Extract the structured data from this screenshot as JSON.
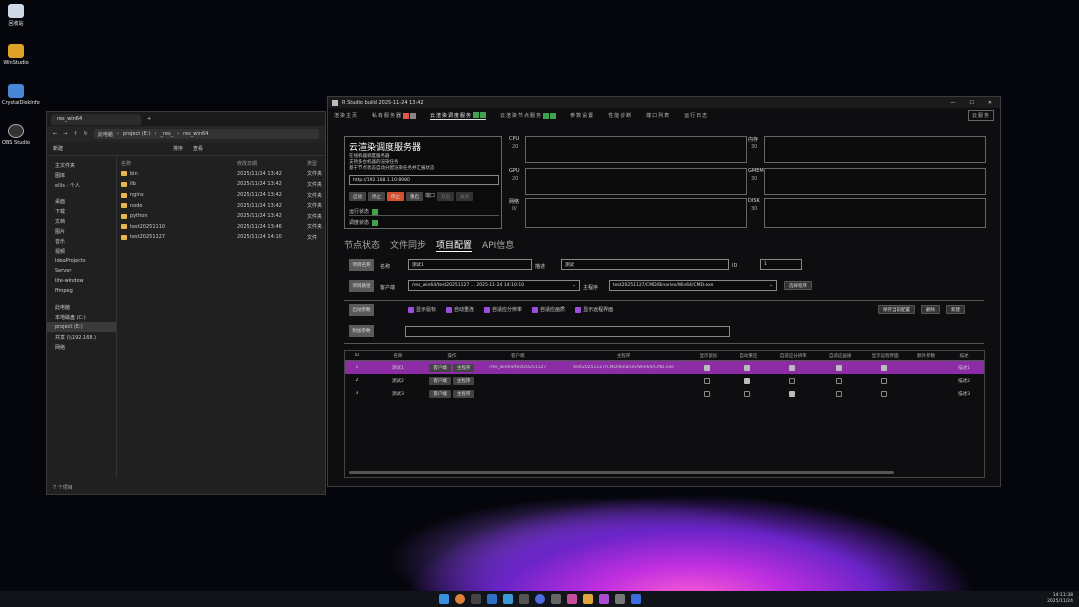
{
  "desktop": {
    "icons": [
      "回收站",
      "WinStudio",
      "CrystalDiskInfo",
      "OBS Studio"
    ]
  },
  "explorer": {
    "tab_title": "res_win64",
    "breadcrumb": [
      "此电脑",
      "project (E:)",
      "_res_",
      "res_win64"
    ],
    "toolbar": [
      "新建",
      "排序",
      "查看"
    ],
    "nav": [
      "主文件夹",
      "图库",
      "ellis - 个人",
      "桌面",
      "下载",
      "文档",
      "图片",
      "音乐",
      "视频",
      "IdeaProjects",
      "Server",
      "lite-window",
      "ffmpeg",
      "图片",
      "此电脑",
      "本地磁盘 (C:)",
      "project (E:)",
      "共享 (\\\\192.168.)",
      "网络"
    ],
    "columns": [
      "名称",
      "修改日期",
      "类型"
    ],
    "rows": [
      {
        "name": "bin",
        "date": "2025/11/24 13:42",
        "type": "文件夹"
      },
      {
        "name": "lib",
        "date": "2025/11/24 13:42",
        "type": "文件夹"
      },
      {
        "name": "nginx",
        "date": "2025/11/24 13:42",
        "type": "文件夹"
      },
      {
        "name": "node",
        "date": "2025/11/24 13:42",
        "type": "文件夹"
      },
      {
        "name": "python",
        "date": "2025/11/24 13:42",
        "type": "文件夹"
      },
      {
        "name": "test20251110",
        "date": "2025/11/24 13:46",
        "type": "文件夹"
      },
      {
        "name": "test20251127",
        "date": "2025/11/24 14:10",
        "type": "文件"
      }
    ],
    "status": "7 个项目"
  },
  "app": {
    "title": "R Studio build 2025-11-24 13:42",
    "menu": [
      "渲染主页",
      "私有服务器",
      "云渲染调度服务",
      "云渲染节点服务",
      "参数设置",
      "性能诊断",
      "端口列表",
      "运行日志"
    ],
    "menu_right": "云服务",
    "server": {
      "title": "云渲染调度服务器",
      "desc": [
        "在线机器调度服务器",
        "支持多台机器的渲染任务",
        "基于节点状态自动分配渲染任务并汇报状态"
      ],
      "url": "http://192.168.1.10:8080",
      "buttons": [
        "启动",
        "停止",
        "停止",
        "重启",
        "端口",
        "开启",
        "关闭"
      ],
      "rows": [
        "运行状态",
        "调度状态"
      ]
    },
    "monitors": [
      {
        "label": "CPU",
        "val": "20"
      },
      {
        "label": "GPU",
        "val": "20"
      },
      {
        "label": "网络",
        "val": "0/"
      },
      {
        "label": "内存",
        "val": "30"
      },
      {
        "label": "GMEM",
        "val": "30"
      },
      {
        "label": "DISK",
        "val": "30"
      }
    ],
    "subtabs": [
      "节点状态",
      "文件同步",
      "项目配置",
      "API信息"
    ],
    "form": {
      "name_label": "项目名称",
      "name_key": "名称",
      "name_value": "测试1",
      "desc_key": "描述",
      "desc_value": "测试",
      "id_key": "ID",
      "id_value": "1",
      "path_label": "项目路径",
      "client_key": "客户端",
      "client_path": "/res_win64/test20251127 ... 2025-11-24 14:10:10",
      "exe_key": "主程序",
      "exe_value": "test20251127/CMD/Binaries/Win64/CMD.exe",
      "choose": "选择程序",
      "opt_label": "启动参数",
      "options": [
        "显示鼠标",
        "自动重连",
        "自适应分辨率",
        "自适应画质",
        "显示远程界面"
      ],
      "opt_buttons": [
        "保存当前配置",
        "删除",
        "新建"
      ],
      "extra_label": "附加参数"
    },
    "table": {
      "headers": [
        "ID",
        "名称",
        "操作",
        "客户端",
        "主程序",
        "显示鼠标",
        "自动重连",
        "自适应分辨率",
        "自适应画质",
        "显示远程界面",
        "额外参数",
        "描述"
      ],
      "rows": [
        {
          "id": "1",
          "name": "测试1",
          "a": "客户端",
          "b": "主程序",
          "client": "/res_win64/test20251127",
          "exe": "test20251127/CMD/Binaries/Win64/CMD.exe",
          "checks": [
            true,
            true,
            true,
            true,
            true
          ],
          "desc": "描述1",
          "sel": true
        },
        {
          "id": "2",
          "name": "测试2",
          "a": "客户端",
          "b": "主程序",
          "client": "",
          "exe": "",
          "checks": [
            false,
            true,
            false,
            false,
            false
          ],
          "desc": "描述2",
          "sel": false
        },
        {
          "id": "3",
          "name": "测试3",
          "a": "客户端",
          "b": "主程序",
          "client": "",
          "exe": "",
          "checks": [
            false,
            false,
            true,
            false,
            false
          ],
          "desc": "描述3",
          "sel": false
        }
      ]
    }
  },
  "tray": {
    "time": "14:11:38",
    "date": "2025/11/24"
  }
}
